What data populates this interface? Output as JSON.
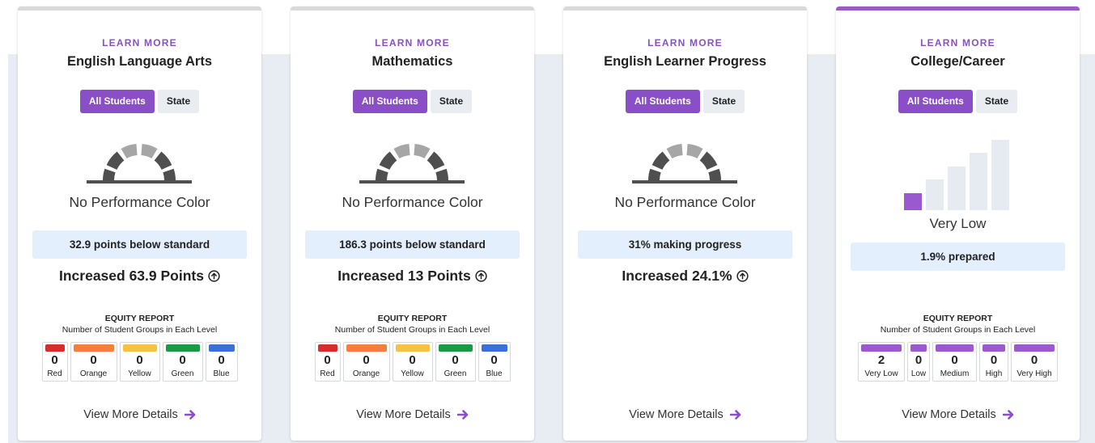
{
  "colors": {
    "accent": "#8a4fc7",
    "gauge_dark": "#4f4f4f",
    "gauge_light": "#a6a6a6",
    "status_bg": "#e3effc",
    "cc_bar_filled": "#9b59d0",
    "cc_bar_empty": "#e6eaf1"
  },
  "cards": [
    {
      "learn_more": "LEARN MORE",
      "title": "English Language Arts",
      "toggle": {
        "all_students": "All Students",
        "state": "State"
      },
      "performance": "No Performance Color",
      "status": "32.9 points below standard",
      "change": "Increased 63.9 Points",
      "change_icon": "arrow-up-circle-icon",
      "equity": {
        "title": "EQUITY REPORT",
        "subtitle": "Number of Student Groups in Each Level",
        "levels": [
          {
            "label": "Red",
            "count": "0",
            "color": "#d62c2c"
          },
          {
            "label": "Orange",
            "count": "0",
            "color": "#f47e3c"
          },
          {
            "label": "Yellow",
            "count": "0",
            "color": "#f6c244"
          },
          {
            "label": "Green",
            "count": "0",
            "color": "#1b9a45"
          },
          {
            "label": "Blue",
            "count": "0",
            "color": "#3a6fd8"
          }
        ]
      },
      "details": "View More Details"
    },
    {
      "learn_more": "LEARN MORE",
      "title": "Mathematics",
      "toggle": {
        "all_students": "All Students",
        "state": "State"
      },
      "performance": "No Performance Color",
      "status": "186.3 points below standard",
      "change": "Increased 13 Points",
      "change_icon": "arrow-up-circle-icon",
      "equity": {
        "title": "EQUITY REPORT",
        "subtitle": "Number of Student Groups in Each Level",
        "levels": [
          {
            "label": "Red",
            "count": "0",
            "color": "#d62c2c"
          },
          {
            "label": "Orange",
            "count": "0",
            "color": "#f47e3c"
          },
          {
            "label": "Yellow",
            "count": "0",
            "color": "#f6c244"
          },
          {
            "label": "Green",
            "count": "0",
            "color": "#1b9a45"
          },
          {
            "label": "Blue",
            "count": "0",
            "color": "#3a6fd8"
          }
        ]
      },
      "details": "View More Details"
    },
    {
      "learn_more": "LEARN MORE",
      "title": "English Learner Progress",
      "toggle": {
        "all_students": "All Students",
        "state": "State"
      },
      "performance": "No Performance Color",
      "status": "31% making progress",
      "change": "Increased 24.1%",
      "change_icon": "arrow-up-circle-icon",
      "details": "View More Details"
    },
    {
      "learn_more": "LEARN MORE",
      "title": "College/Career",
      "toggle": {
        "all_students": "All Students",
        "state": "State"
      },
      "level_bars": {
        "filled": 1,
        "total": 5
      },
      "performance": "Very Low",
      "status": "1.9% prepared",
      "equity": {
        "title": "EQUITY REPORT",
        "subtitle": "Number of Student Groups in Each Level",
        "levels": [
          {
            "label": "Very Low",
            "count": "2",
            "color": "#9b59d0"
          },
          {
            "label": "Low",
            "count": "0",
            "color": "#9b59d0"
          },
          {
            "label": "Medium",
            "count": "0",
            "color": "#9b59d0"
          },
          {
            "label": "High",
            "count": "0",
            "color": "#9b59d0"
          },
          {
            "label": "Very High",
            "count": "0",
            "color": "#9b59d0"
          }
        ]
      },
      "details": "View More Details"
    }
  ]
}
